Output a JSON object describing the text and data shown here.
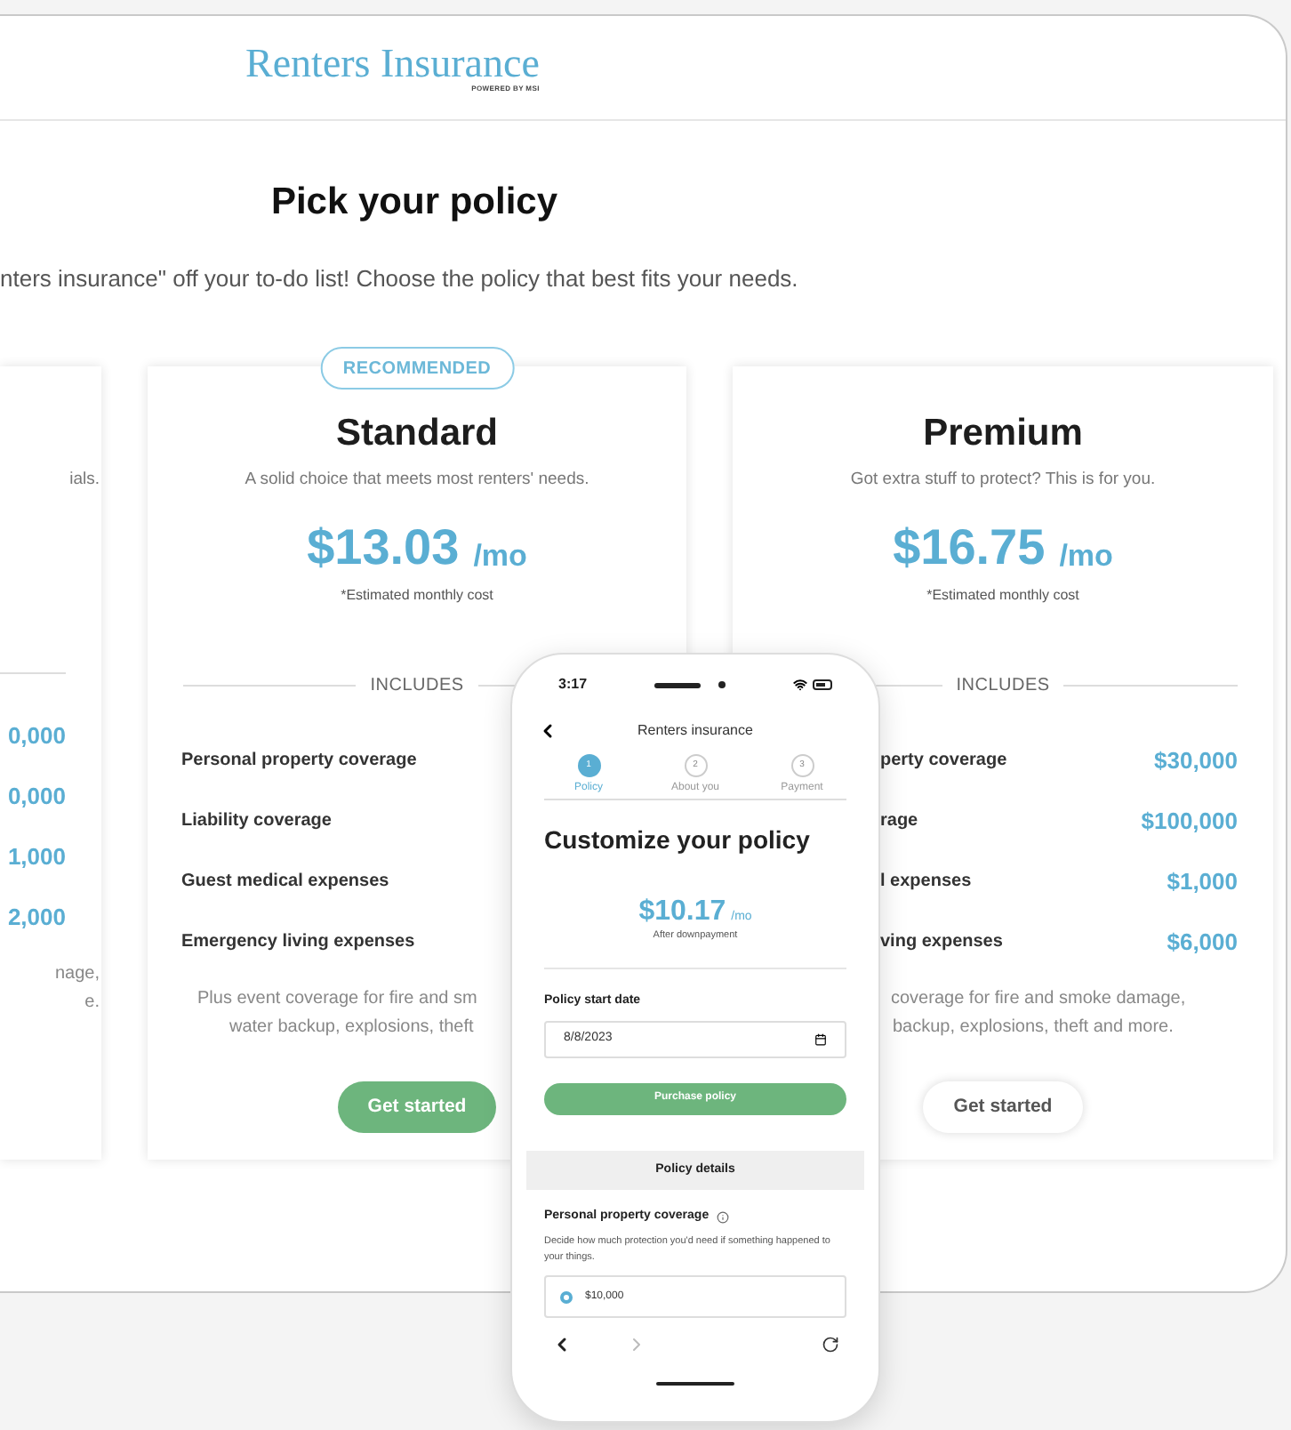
{
  "header": {
    "logo": "Renters Insurance",
    "tagline": "POWERED BY MSI"
  },
  "page": {
    "title": "Pick your policy",
    "subtitle": "nters insurance\" off your to-do list! Choose the policy that best fits your needs."
  },
  "plans": [
    {
      "kind": "left",
      "description": "ials.",
      "rows": [
        {
          "value": "0,000"
        },
        {
          "value": "0,000"
        },
        {
          "value": "1,000"
        },
        {
          "value": "2,000"
        }
      ],
      "footnote": [
        "nage,",
        "e."
      ]
    },
    {
      "kind": "middle",
      "badge": "RECOMMENDED",
      "name": "Standard",
      "description": "A solid choice that meets most renters' needs.",
      "price": "$13.03",
      "per": "/mo",
      "note": "*Estimated monthly cost",
      "includes": "INCLUDES",
      "rows": [
        {
          "label": "Personal property coverage"
        },
        {
          "label": "Liability coverage"
        },
        {
          "label": "Guest medical expenses"
        },
        {
          "label": "Emergency living expenses"
        }
      ],
      "footnote": [
        "Plus event coverage for fire and sm",
        "water backup, explosions, theft"
      ],
      "button": {
        "label": "Get started",
        "primary": true
      }
    },
    {
      "kind": "right",
      "name": "Premium",
      "description": "Got extra stuff to protect? This is for you.",
      "price": "$16.75",
      "per": "/mo",
      "note": "*Estimated monthly cost",
      "includes": "INCLUDES",
      "rows": [
        {
          "label": "perty coverage",
          "value": "$30,000"
        },
        {
          "label": "rage",
          "value": "$100,000"
        },
        {
          "label": "l expenses",
          "value": "$1,000"
        },
        {
          "label": "ving expenses",
          "value": "$6,000"
        }
      ],
      "footnote": [
        "coverage for fire and smoke damage,",
        "backup, explosions, theft and more."
      ],
      "button": {
        "label": "Get started",
        "primary": false
      }
    }
  ],
  "phone": {
    "time": "3:17",
    "nav_title": "Renters insurance",
    "steps": [
      {
        "number": "1",
        "label": "Policy",
        "selected": true
      },
      {
        "number": "2",
        "label": "About you",
        "selected": false
      },
      {
        "number": "3",
        "label": "Payment",
        "selected": false
      }
    ],
    "title": "Customize your policy",
    "price": "$10.17",
    "per": "/mo",
    "price_note": "After downpayment",
    "date_label": "Policy start date",
    "date_value": "8/8/2023",
    "button": "Purchase policy",
    "section": "Policy details",
    "coverage_label": "Personal property coverage",
    "coverage_help": "Decide how much protection you'd need if something happened to your things.",
    "options": [
      {
        "label": "$10,000",
        "selected": true
      }
    ]
  }
}
